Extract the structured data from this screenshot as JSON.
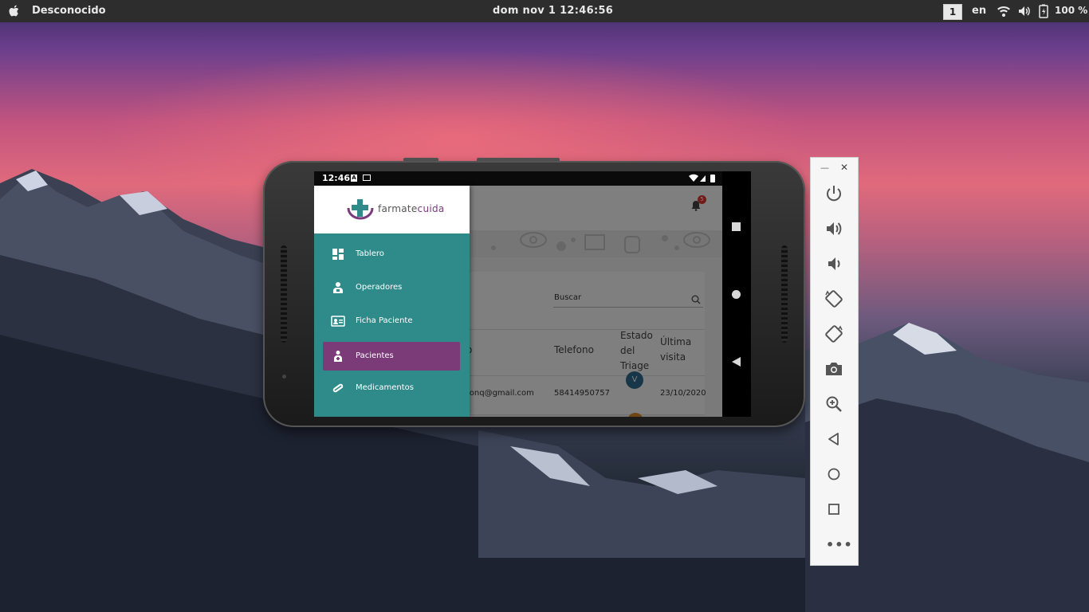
{
  "topbar": {
    "app_name": "Desconocido",
    "clock": "dom nov 1  12:46:56",
    "workspace": "1",
    "language": "en",
    "battery": "100 %"
  },
  "android": {
    "status_time": "12:46"
  },
  "app": {
    "notification_count": "5",
    "search_placeholder": "Buscar",
    "table": {
      "headers": [
        "o",
        "Telefono",
        "Estado del Triage",
        "Última visita"
      ],
      "rows": [
        {
          "email": "ionq@gmail.com",
          "phone": "58414950757",
          "triage": "V",
          "last_visit": "23/10/2020"
        }
      ]
    }
  },
  "drawer": {
    "logo_prefix": "farmate",
    "logo_suffix": "cuida",
    "items": [
      {
        "label": "Tablero",
        "icon": "dashboard-icon"
      },
      {
        "label": "Operadores",
        "icon": "operators-icon"
      },
      {
        "label": "Ficha Paciente",
        "icon": "patient-card-icon"
      },
      {
        "label": "Pacientes",
        "icon": "patients-icon",
        "active": true
      },
      {
        "label": "Medicamentos",
        "icon": "pill-icon"
      }
    ]
  },
  "emulator": {
    "buttons": [
      "power-icon",
      "volume-up-icon",
      "volume-down-icon",
      "rotate-left-icon",
      "rotate-right-icon",
      "camera-icon",
      "zoom-icon",
      "back-icon",
      "home-icon",
      "overview-icon",
      "more-icon"
    ]
  },
  "colors": {
    "drawer": "#2e8b8a",
    "active_item": "#7a3b78",
    "topbar": "#2d2d2d"
  }
}
